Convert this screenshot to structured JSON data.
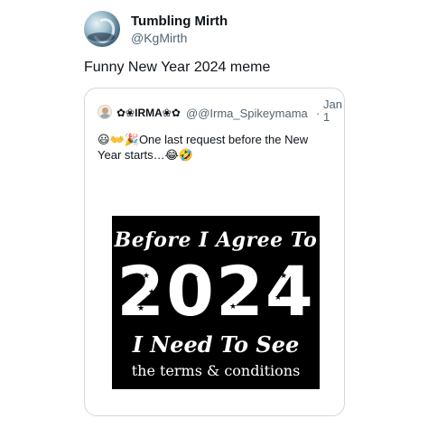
{
  "author": {
    "display_name": "Tumbling Mirth",
    "handle": "@KgMirth",
    "avatar_icon": "profile-avatar"
  },
  "tweet": {
    "text": "Funny New Year 2024 meme"
  },
  "quoted": {
    "display_name": "✿❀IRMA❀✿",
    "handle": "@@Irma_Spikeymama",
    "separator": "·",
    "date": "Jan 1",
    "text_prefix_emoji": "😃👐🎉",
    "text": "One last request before the New Year starts…",
    "text_suffix_emoji": "😂🤣",
    "avatar_icon": "profile-avatar"
  },
  "meme": {
    "line1": "Before I Agree To",
    "year": "2024",
    "line3": "I Need To See",
    "line4": "the terms & conditions",
    "background": "#000000",
    "text_color": "#ffffff"
  }
}
